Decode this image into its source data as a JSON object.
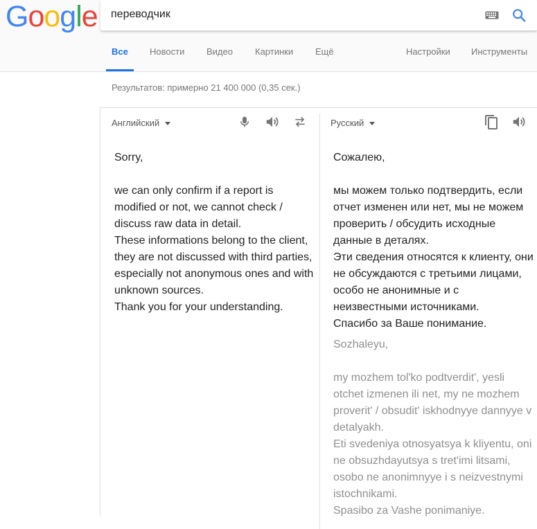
{
  "logo": {
    "letters": [
      "G",
      "o",
      "o",
      "g",
      "l",
      "e"
    ],
    "colors": [
      "#4285F4",
      "#EA4335",
      "#FBBC05",
      "#4285F4",
      "#34A853",
      "#EA4335"
    ]
  },
  "search": {
    "query": "переводчик"
  },
  "tabs": [
    {
      "label": "Все",
      "active": true
    },
    {
      "label": "Новости"
    },
    {
      "label": "Видео"
    },
    {
      "label": "Картинки"
    },
    {
      "label": "Ещё"
    },
    {
      "label": "Настройки"
    },
    {
      "label": "Инструменты"
    }
  ],
  "result_stats": "Результатов: примерно 21 400 000 (0,35 сек.)",
  "translator": {
    "source_lang": "Английский",
    "target_lang": "Русский",
    "source_text": "Sorry,\n\nwe can only confirm if a report is modified or not, we cannot check / discuss raw data in detail.\nThese informations belong to the client, they are not discussed with third parties, especially not anonymous ones and with unknown sources.\nThank you for your understanding.",
    "target_text": "Сожалею,\n\nмы можем только подтвердить, если отчет изменен или нет, мы не можем проверить / обсудить исходные данные в деталях.\nЭти сведения относятся к клиенту, они не обсуждаются с третьими лицами, особо не анонимные и с неизвестными источниками.\nСпасибо за Ваше понимание.",
    "transliteration": "Sozhaleyu,\n\nmy mozhem tol'ko podtverdit', yesli otchet izmenen ili net, my ne mozhem proverit' / obsudit' iskhodnyye dannyye v detalyakh.\nEti svedeniya otnosyatsya k kliyentu, oni ne obsuzhdayutsya s tret'imi litsami, osobo ne anonimnyye i s neizvestnymi istochnikami.\nSpasibo za Vashe ponimaniye."
  },
  "icons": {
    "keyboard": "keyboard-icon",
    "search": "search-icon",
    "mic": "microphone-icon",
    "speaker": "speaker-icon",
    "swap": "swap-icon",
    "copy": "copy-icon"
  },
  "colors": {
    "accent": "#1a73e8",
    "icon": "#757575"
  }
}
